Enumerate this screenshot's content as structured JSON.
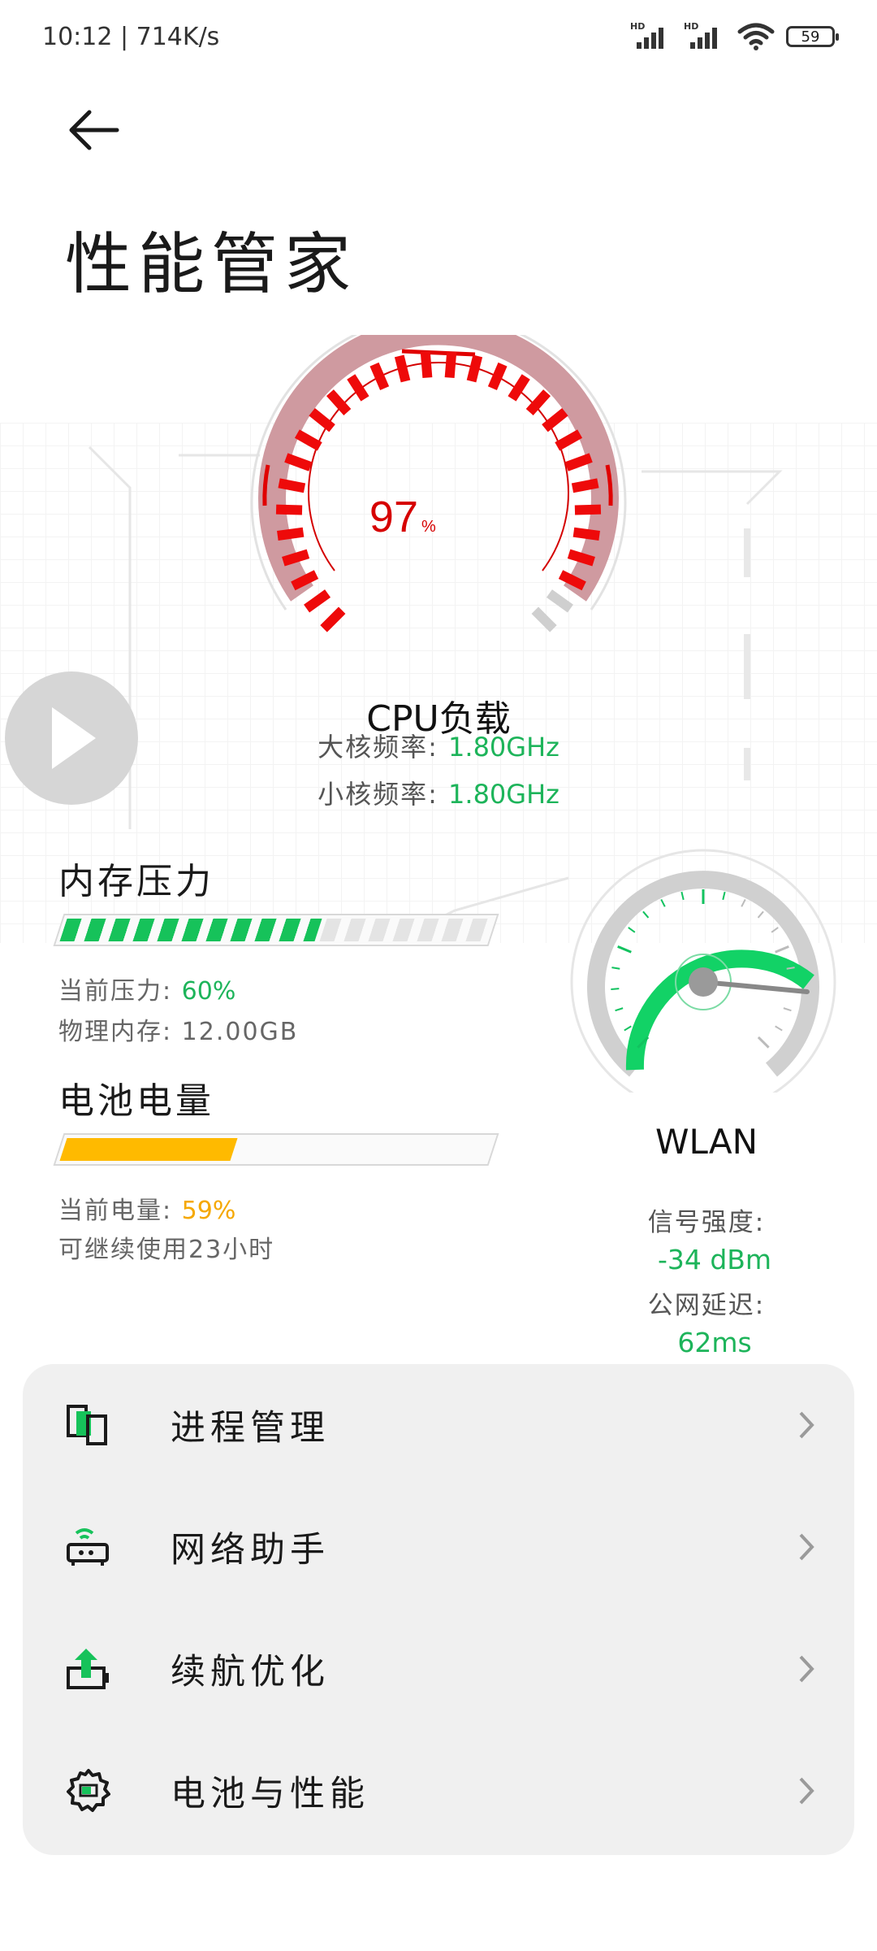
{
  "status_bar": {
    "time_speed": "10:12 | 714K/s",
    "battery": "59"
  },
  "header": {
    "title": "性能管家"
  },
  "cpu": {
    "percent_value": "97",
    "percent_unit": "%",
    "label": "CPU负载",
    "big_core_label": "大核频率: ",
    "big_core_value": "1.80GHz",
    "small_core_label": "小核频率: ",
    "small_core_value": "1.80GHz",
    "load": 0.97
  },
  "memory": {
    "title": "内存压力",
    "pressure_label": "当前压力: ",
    "pressure_value": "60%",
    "physical_label": "物理内存: ",
    "physical_value": "12.00GB",
    "pressure": 0.6
  },
  "battery_section": {
    "title": "电池电量",
    "level_label": "当前电量: ",
    "level_value": "59%",
    "remaining": "可继续使用23小时",
    "level": 0.59
  },
  "wlan": {
    "label": "WLAN",
    "signal_label": "信号强度:",
    "signal_value": "-34 dBm",
    "latency_label": "公网延迟:",
    "latency_value": "62ms"
  },
  "menu": [
    {
      "label": "进程管理",
      "icon": "process-icon"
    },
    {
      "label": "网络助手",
      "icon": "router-icon"
    },
    {
      "label": "续航优化",
      "icon": "battery-boost-icon"
    },
    {
      "label": "电池与性能",
      "icon": "gear-icon"
    }
  ],
  "colors": {
    "accent_green": "#1db45a",
    "cpu_red": "#e8000a",
    "battery_yellow": "#ffba00",
    "card_bg": "#f0f0f0"
  }
}
